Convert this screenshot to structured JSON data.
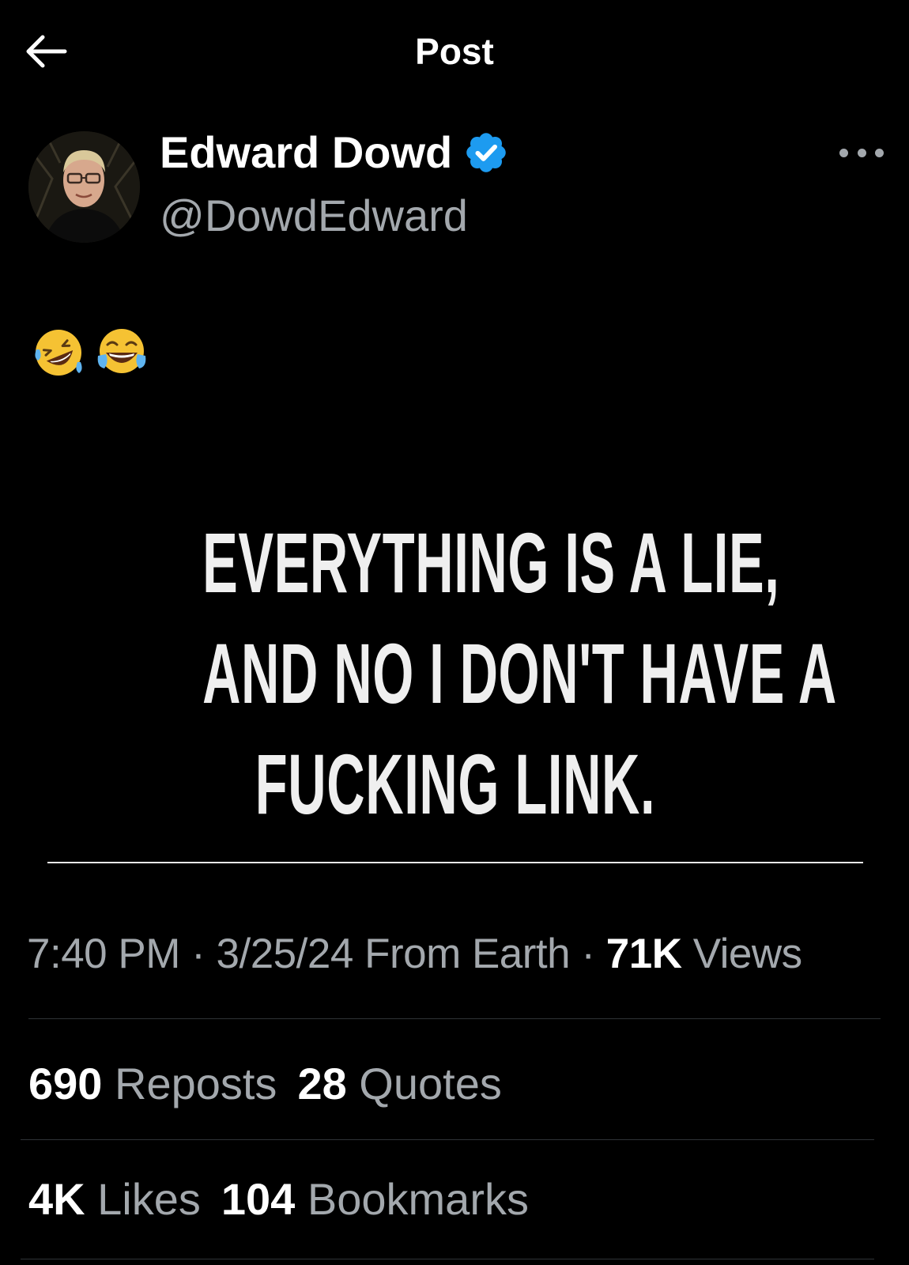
{
  "header": {
    "title": "Post"
  },
  "author": {
    "display_name": "Edward Dowd",
    "handle": "@DowdEdward",
    "verified": true
  },
  "post": {
    "emojis": [
      "rolling-on-floor-laughing",
      "face-with-tears-of-joy"
    ],
    "image_text": {
      "line1": "EVERYTHING IS A LIE,",
      "line2": "AND NO I DON'T HAVE A",
      "line3": "FUCKING LINK."
    },
    "time": "7:40 PM",
    "separator": " · ",
    "date": "3/25/24",
    "location": "From Earth",
    "views_count": "71K",
    "views_label": "Views"
  },
  "stats": {
    "reposts_count": "690",
    "reposts_label": "Reposts",
    "quotes_count": "28",
    "quotes_label": "Quotes",
    "likes_count": "4K",
    "likes_label": "Likes",
    "bookmarks_count": "104",
    "bookmarks_label": "Bookmarks"
  },
  "colors": {
    "background": "#000000",
    "primary_text": "#ffffff",
    "secondary_text": "#a3a8ad",
    "verified_badge": "#1d9bf0",
    "divider": "#2f3336"
  }
}
